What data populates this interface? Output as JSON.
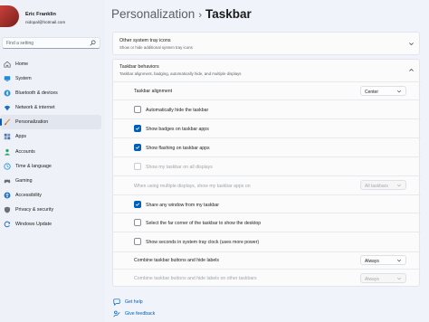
{
  "profile": {
    "name": "Eric Franklin",
    "email": "nidopal@hotmail.com"
  },
  "search": {
    "placeholder": "Find a setting"
  },
  "nav": {
    "items": [
      {
        "label": "Home",
        "icon": "home-icon",
        "color": "#555b66"
      },
      {
        "label": "System",
        "icon": "monitor-icon",
        "color": "#1f8ad8"
      },
      {
        "label": "Bluetooth & devices",
        "icon": "bluetooth-icon",
        "color": "#1f8ad8"
      },
      {
        "label": "Network & internet",
        "icon": "wifi-icon",
        "color": "#1f6fc4"
      },
      {
        "label": "Personalization",
        "icon": "brush-icon",
        "color": "#e08a2c",
        "active": true
      },
      {
        "label": "Apps",
        "icon": "apps-icon",
        "color": "#4b6fa8"
      },
      {
        "label": "Accounts",
        "icon": "person-icon",
        "color": "#2ea36b"
      },
      {
        "label": "Time & language",
        "icon": "globe-clock-icon",
        "color": "#1f8ad8"
      },
      {
        "label": "Gaming",
        "icon": "gamepad-icon",
        "color": "#666c75"
      },
      {
        "label": "Accessibility",
        "icon": "accessibility-icon",
        "color": "#1f6fc4"
      },
      {
        "label": "Privacy & security",
        "icon": "shield-icon",
        "color": "#6b7079"
      },
      {
        "label": "Windows Update",
        "icon": "update-icon",
        "color": "#1f6fc4"
      }
    ]
  },
  "header": {
    "parent": "Personalization",
    "separator": "›",
    "current": "Taskbar"
  },
  "system_tray_icons": {
    "title": "Other system tray icons",
    "subtitle": "Show or hide additional system tray icons"
  },
  "behaviors": {
    "title": "Taskbar behaviors",
    "subtitle": "Taskbar alignment, badging, automatically hide, and multiple displays",
    "alignment_label": "Taskbar alignment",
    "alignment_value": "Center",
    "auto_hide": {
      "label": "Automatically hide the taskbar",
      "checked": false
    },
    "badges": {
      "label": "Show badges on taskbar apps",
      "checked": true
    },
    "flashing": {
      "label": "Show flashing on taskbar apps",
      "checked": true
    },
    "all_displays": {
      "label": "Show my taskbar on all displays",
      "checked": false,
      "disabled": true
    },
    "multi_display_label": "When using multiple displays, show my taskbar apps on",
    "multi_display_value": "All taskbars",
    "share_window": {
      "label": "Share any window from my taskbar",
      "checked": true
    },
    "far_corner": {
      "label": "Select the far corner of the taskbar to show the desktop",
      "checked": false
    },
    "seconds": {
      "label": "Show seconds in system tray clock (uses more power)",
      "checked": false
    },
    "combine_label": "Combine taskbar buttons and hide labels",
    "combine_value": "Always",
    "combine_other_label": "Combine taskbar buttons and hide labels on other taskbars",
    "combine_other_value": "Always"
  },
  "links": {
    "help": "Get help",
    "feedback": "Give feedback"
  },
  "colors": {
    "accent": "#005fb8"
  }
}
